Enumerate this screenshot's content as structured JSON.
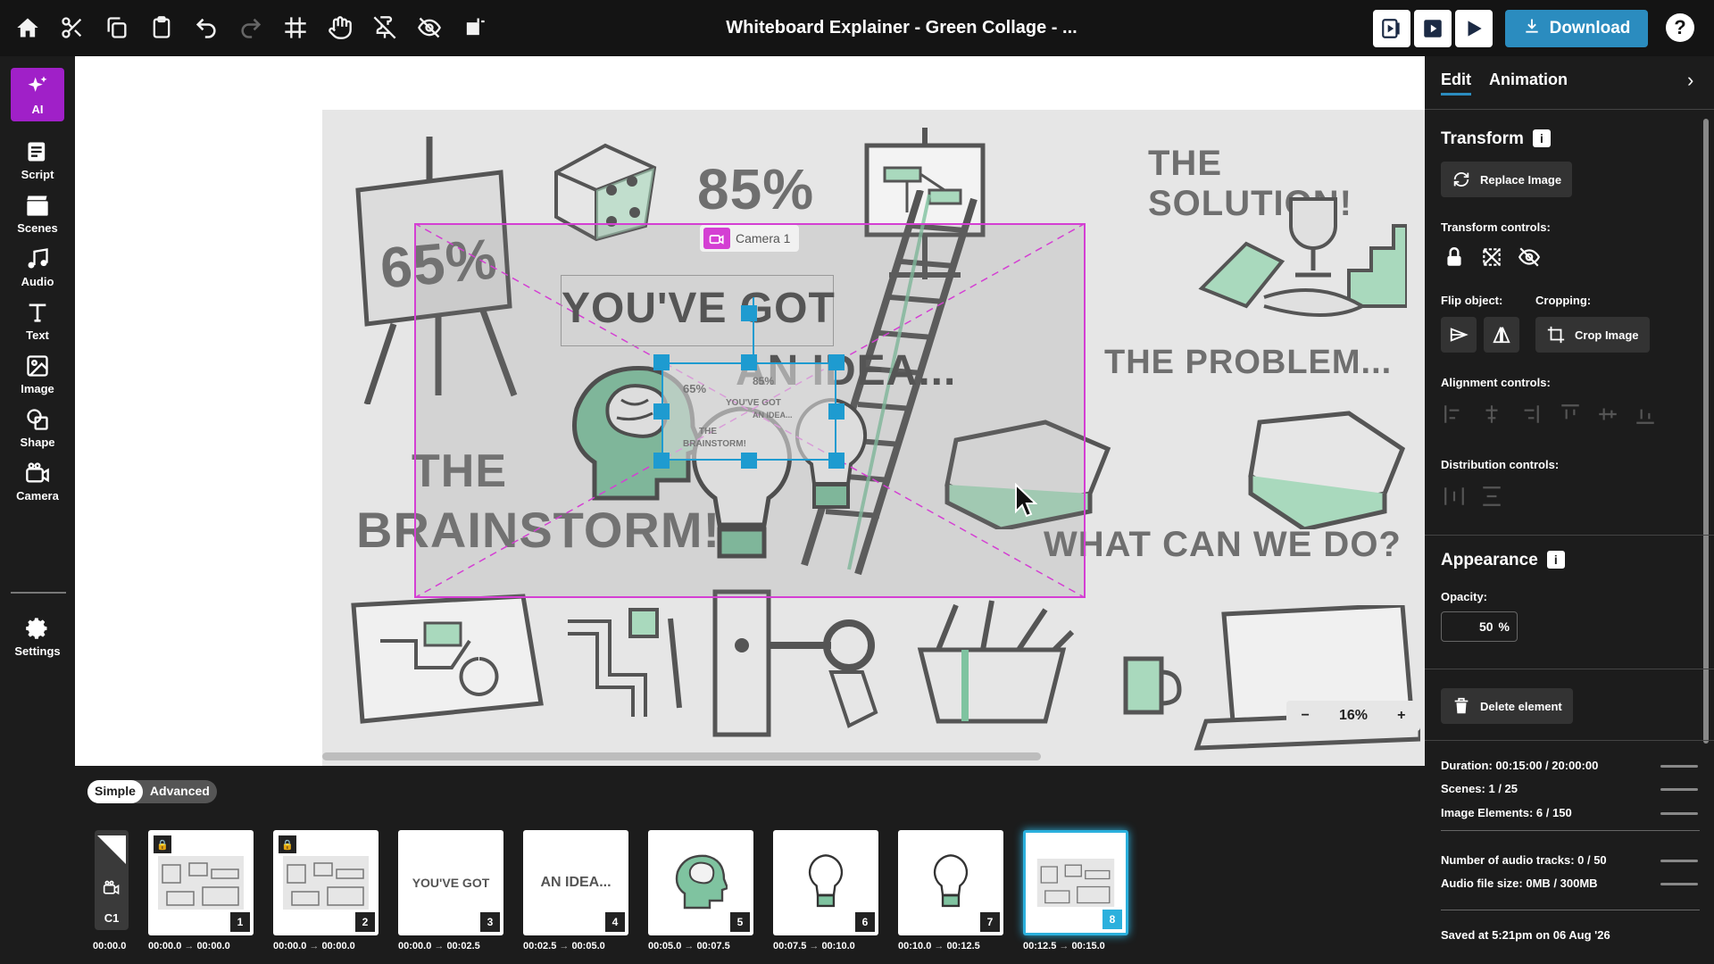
{
  "header": {
    "title": "Whiteboard Explainer - Green Collage - ...",
    "download_label": "Download",
    "help_label": "?"
  },
  "sidebar": {
    "items": [
      {
        "label": "AI",
        "icon": "sparkle-icon"
      },
      {
        "label": "Script",
        "icon": "script-icon"
      },
      {
        "label": "Scenes",
        "icon": "scenes-icon"
      },
      {
        "label": "Audio",
        "icon": "music-note-icon"
      },
      {
        "label": "Text",
        "icon": "text-icon"
      },
      {
        "label": "Image",
        "icon": "image-icon"
      },
      {
        "label": "Shape",
        "icon": "shape-icon"
      },
      {
        "label": "Camera",
        "icon": "camera-icon"
      },
      {
        "label": "Settings",
        "icon": "gear-icon"
      }
    ]
  },
  "canvas": {
    "texts": {
      "pct65": "65%",
      "pct85": "85%",
      "solution": "THE SOLUTION!",
      "youve_got": "YOU'VE GOT",
      "an_idea": "AN IDEA...",
      "problem": "THE PROBLEM...",
      "the": "THE",
      "brainstorm": "BRAINSTORM!",
      "what_can": "WHAT CAN WE DO?"
    },
    "camera_label": "Camera 1",
    "zoom": "16%",
    "zoom_minus": "−",
    "zoom_plus": "+",
    "sel_texts": {
      "pct65": "65%",
      "pct85": "85%",
      "youve_got": "YOU'VE GOT",
      "an_idea": "AN IDEA...",
      "the": "THE",
      "brainstorm": "BRAINSTORM!"
    }
  },
  "panel": {
    "tabs": [
      "Edit",
      "Animation"
    ],
    "close_icon": "chevron-right-icon",
    "transform_title": "Transform",
    "info_label": "i",
    "replace_image": "Replace Image",
    "transform_controls": "Transform controls:",
    "flip_object": "Flip object:",
    "cropping": "Cropping:",
    "crop_image": "Crop Image",
    "alignment_controls": "Alignment controls:",
    "distribution_controls": "Distribution controls:",
    "appearance_title": "Appearance",
    "opacity_label": "Opacity:",
    "opacity_value": "50",
    "opacity_unit": "%",
    "delete_element": "Delete element",
    "stats": {
      "duration": "Duration: 00:15:00 / 20:00:00",
      "scenes": "Scenes: 1 / 25",
      "image_elements": "Image Elements: 6 / 150",
      "audio_tracks": "Number of audio tracks: 0 / 50",
      "audio_size": "Audio file size: 0MB / 300MB",
      "saved": "Saved at 5:21pm on 06 Aug '26"
    }
  },
  "timeline": {
    "mode_simple": "Simple",
    "mode_advanced": "Advanced",
    "camera_thumb": {
      "label": "C1",
      "time": "00:00.0"
    },
    "arrow": "→",
    "thumbs": [
      {
        "num": "1",
        "start": "00:00.0",
        "end": "00:00.0",
        "text": "",
        "locked": true
      },
      {
        "num": "2",
        "start": "00:00.0",
        "end": "00:00.0",
        "text": "",
        "locked": true
      },
      {
        "num": "3",
        "start": "00:00.0",
        "end": "00:02.5",
        "text": "YOU'VE GOT",
        "locked": false
      },
      {
        "num": "4",
        "start": "00:02.5",
        "end": "00:05.0",
        "text": "AN IDEA...",
        "locked": false
      },
      {
        "num": "5",
        "start": "00:05.0",
        "end": "00:07.5",
        "text": "",
        "locked": false
      },
      {
        "num": "6",
        "start": "00:07.5",
        "end": "00:10.0",
        "text": "",
        "locked": false
      },
      {
        "num": "7",
        "start": "00:10.0",
        "end": "00:12.5",
        "text": "",
        "locked": false
      },
      {
        "num": "8",
        "start": "00:12.5",
        "end": "00:15.0",
        "text": "",
        "locked": false
      }
    ]
  },
  "colors": {
    "accent": "#2b8cbf",
    "ai_active": "#a020c8",
    "camera_frame": "#d43fd3",
    "selection": "#1e9bd0",
    "doodle_green": "#7fc3a0"
  }
}
